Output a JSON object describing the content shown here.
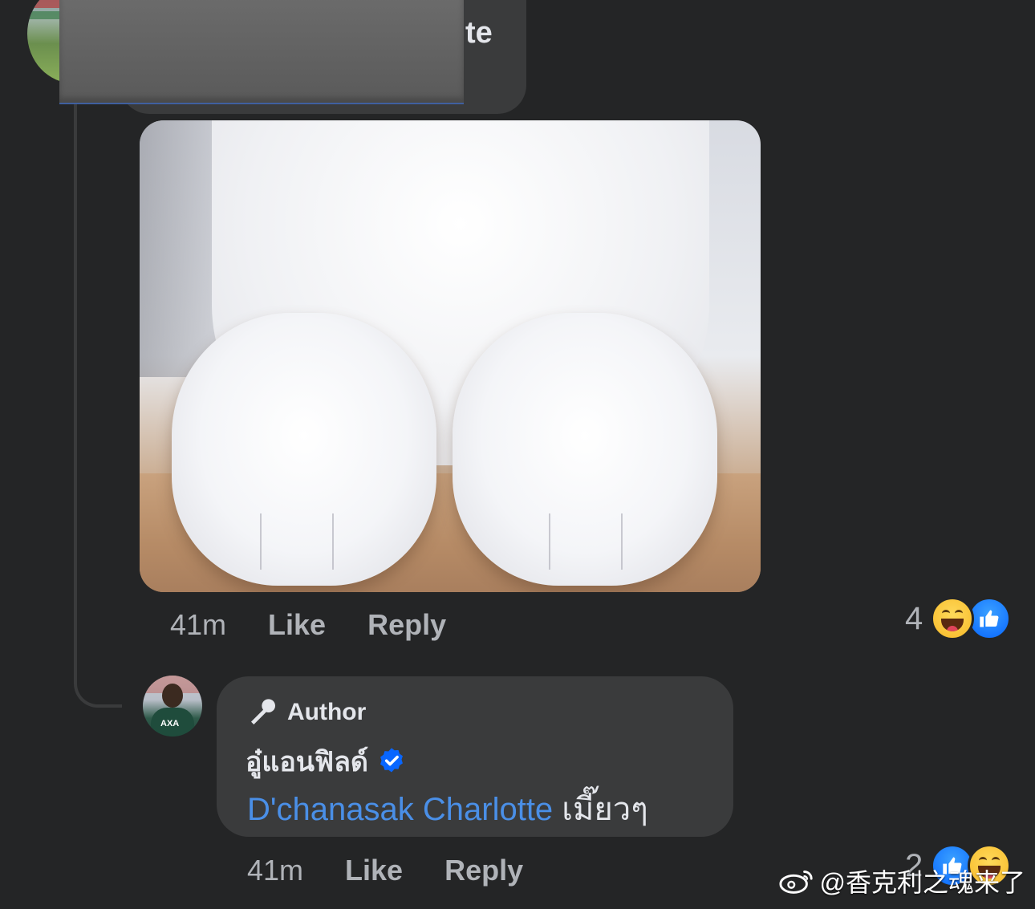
{
  "top_comment": {
    "name_suffix": "te",
    "time": "41m",
    "like_label": "Like",
    "reply_label": "Reply",
    "reaction_count": "4",
    "reactions": [
      "haha-icon",
      "like-icon"
    ]
  },
  "reply_comment": {
    "badge_label": "Author",
    "author_name": "อู๋แอนฟิลด์",
    "mention": "D'chanasak Charlotte",
    "text": "เมี๊ยวๆ",
    "time": "41m",
    "like_label": "Like",
    "reply_label": "Reply",
    "reaction_count": "2",
    "reactions": [
      "like-icon",
      "haha-icon"
    ]
  },
  "watermark": {
    "text": "@香克利之魂来了"
  },
  "colors": {
    "background": "#242526",
    "bubble": "#3a3b3c",
    "mention": "#4a8fe7",
    "verified": "#0866ff"
  }
}
